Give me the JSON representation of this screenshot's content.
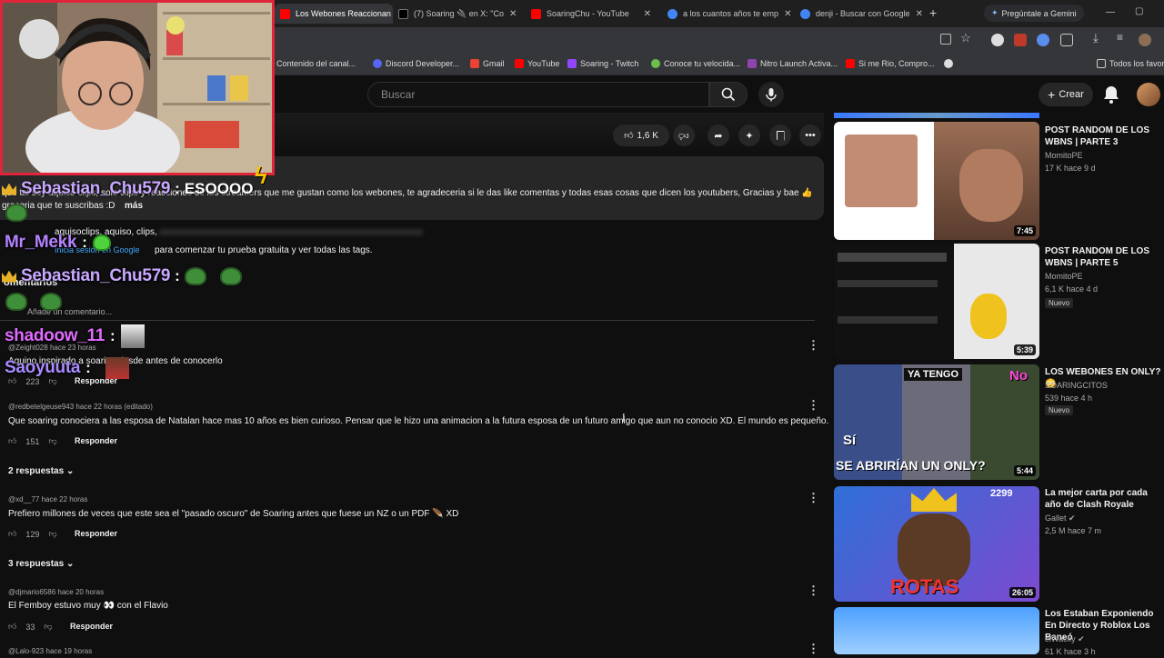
{
  "browser": {
    "tabs": [
      {
        "label": "Los Webones Reaccionan a",
        "close": "✕",
        "color": "#ff0000"
      },
      {
        "label": "(7) Soaring 🔌 en X: \"Co",
        "close": "✕",
        "color": "#000000"
      },
      {
        "label": "SoaringChu - YouTube",
        "close": "✕",
        "color": "#ff0000"
      },
      {
        "label": "a los cuantos años te emp",
        "close": "✕",
        "color": "#4285f4"
      },
      {
        "label": "denji - Buscar con Google",
        "close": "✕",
        "color": "#4285f4"
      }
    ],
    "new_tab": "+",
    "gemini": "Pregúntale a Gemini",
    "bookmarks": [
      "Contenido del canal...",
      "Discord Developer...",
      "Gmail",
      "YouTube",
      "Soaring - Twitch",
      "Conoce tu velocida...",
      "Nitro Launch Activa...",
      "Si me Rio, Compro...",
      "Todos los favori"
    ],
    "window_controls": [
      "—",
      "▢",
      "✕"
    ]
  },
  "youtube": {
    "search_placeholder": "Buscar",
    "create_label": "Crear",
    "create_plus": "+",
    "likes": "1,6 K"
  },
  "description": {
    "line1": "que tal soy aquiso clips, solo clips y reacciones de los streamers que me gustan como los webones, te agradeceria si le das like comentas y todas esas cosas que dicen los youtubers, Gracias y bae 👍",
    "line2": "graceria que te suscribas :D",
    "more": "más",
    "tags": "aquisoclips, aquiso, clips,",
    "signin_link": "Inicia sesión en Google",
    "signin_text": "para comenzar tu prueba gratuita y ver todas las tags.",
    "comments_heading": "omentarios",
    "add_comment": "Añade un comentario..."
  },
  "chat": [
    {
      "name": "Sebastian_Chu579",
      "color": "#c8a8ff",
      "msg": "ESOOOO",
      "badge": true
    },
    {
      "name": "Mr_Mekk",
      "color": "#b482ff",
      "msg": "",
      "badge": false
    },
    {
      "name": "Sebastian_Chu579",
      "color": "#c8a8ff",
      "msg": "",
      "badge": true
    },
    {
      "name": "shadoow_11",
      "color": "#e06bff",
      "msg": "",
      "badge": false
    },
    {
      "name": "Saoyuuta",
      "color": "#a98bff",
      "msg": "",
      "badge": false
    }
  ],
  "comments": [
    {
      "handle": "@Zeight028",
      "time": "hace 23 horas",
      "text": "Aquino inspirado a soaring desde antes de conocerlo",
      "likes": "223",
      "reply": "Responder"
    },
    {
      "handle": "@redbetelgeuse943",
      "time": "hace 22 horas (editado)",
      "text": "Que soaring conociera a las esposa de Natalan hace mas 10 años es bien curioso. Pensar que le hizo una animacion a la futura esposa de un futuro amigo que aun no conocio XD. El mundo es pequeño.",
      "likes": "151",
      "reply": "Responder",
      "replies": "2 respuestas"
    },
    {
      "handle": "@xd__77",
      "time": "hace 22 horas",
      "text": "Prefiero millones de veces que este sea el \"pasado oscuro\" de Soaring antes que fuese un NZ o un PDF 🪶 XD",
      "likes": "129",
      "reply": "Responder",
      "replies": "3 respuestas"
    },
    {
      "handle": "@djmario6586",
      "time": "hace 20 horas",
      "text": "El Femboy estuvo muy 👀 con el Flavio",
      "likes": "33",
      "reply": "Responder"
    },
    {
      "handle": "@Lalo-923",
      "time": "hace 19 horas",
      "text": "",
      "likes": "",
      "reply": ""
    }
  ],
  "sidebar": [
    {
      "title": "POST RANDOM DE LOS WBNS | PARTE 3",
      "channel": "MomitoPE",
      "stats": "17 K  hace 9 d",
      "badge": "",
      "duration": "7:45"
    },
    {
      "title": "POST RANDOM DE LOS WBNS | PARTE 5",
      "channel": "MomitoPE",
      "stats": "6,1 K  hace 4 d",
      "badge": "Nuevo",
      "duration": "5:39"
    },
    {
      "title": "LOS WEBONES EN ONLY? 😳",
      "channel": "SOARINGCITOS",
      "stats": "539  hace 4 h",
      "badge": "Nuevo",
      "duration": "5:44"
    },
    {
      "title": "La mejor carta por cada año de Clash Royale",
      "channel": "Gallet ✔",
      "stats": "2,5 M  hace 7 m",
      "badge": "",
      "duration": "26:05"
    },
    {
      "title": "Los Estaban Exponiendo En Directo y Roblox Los Baneó",
      "channel": "elWacky ✔",
      "stats": "61 K  hace 3 h",
      "badge": "",
      "duration": ""
    }
  ],
  "thumb_text": {
    "t3_ya": "YA TENGO",
    "t3_no": "No",
    "t3_si": "Sí",
    "t3_bottom": "SE ABRIRÍAN UN ONLY?",
    "t4_bottom": "ROTAS",
    "t4_num": "2299"
  }
}
